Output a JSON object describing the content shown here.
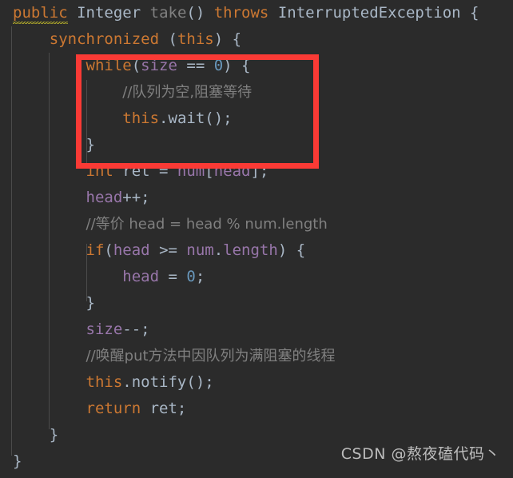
{
  "editor": {
    "theme": "darcula",
    "background_color": "#2b2b2b",
    "language": "java",
    "colors": {
      "keyword": "#cc7832",
      "plain": "#a9b7c6",
      "field": "#9876aa",
      "number": "#6897bb",
      "comment": "#808080",
      "dimmed_method": "#808080",
      "warning_squiggle": "#bbb529",
      "indent_guide": "#4b4b4b",
      "annotation_red": "#fa3a35"
    }
  },
  "code_lines": [
    {
      "id": "line-1",
      "indent": 0,
      "tokens": [
        {
          "text": "public",
          "kind": "keyword",
          "warning_underline": true
        },
        {
          "text": " ",
          "kind": "plain"
        },
        {
          "text": "Integer",
          "kind": "class"
        },
        {
          "text": " ",
          "kind": "plain"
        },
        {
          "text": "take",
          "kind": "dimmed_method"
        },
        {
          "text": "() ",
          "kind": "plain"
        },
        {
          "text": "throws",
          "kind": "keyword"
        },
        {
          "text": " ",
          "kind": "plain"
        },
        {
          "text": "InterruptedException",
          "kind": "class"
        },
        {
          "text": " {",
          "kind": "plain"
        }
      ]
    },
    {
      "id": "line-2",
      "indent": 1,
      "tokens": [
        {
          "text": "synchronized",
          "kind": "keyword"
        },
        {
          "text": " (",
          "kind": "plain"
        },
        {
          "text": "this",
          "kind": "keyword"
        },
        {
          "text": ") {",
          "kind": "plain"
        }
      ]
    },
    {
      "id": "line-3",
      "indent": 2,
      "tokens": [
        {
          "text": "while",
          "kind": "keyword"
        },
        {
          "text": "(",
          "kind": "plain"
        },
        {
          "text": "size",
          "kind": "field"
        },
        {
          "text": " == ",
          "kind": "plain"
        },
        {
          "text": "0",
          "kind": "number"
        },
        {
          "text": ") {",
          "kind": "plain"
        }
      ]
    },
    {
      "id": "line-4",
      "indent": 3,
      "tokens": [
        {
          "text": "//队列为空,阻塞等待",
          "kind": "comment"
        }
      ]
    },
    {
      "id": "line-5",
      "indent": 3,
      "tokens": [
        {
          "text": "this",
          "kind": "keyword"
        },
        {
          "text": ".",
          "kind": "plain"
        },
        {
          "text": "wait",
          "kind": "plain"
        },
        {
          "text": "();",
          "kind": "plain"
        }
      ]
    },
    {
      "id": "line-6",
      "indent": 2,
      "tokens": [
        {
          "text": "}",
          "kind": "plain"
        }
      ]
    },
    {
      "id": "line-7",
      "indent": 2,
      "tokens": [
        {
          "text": "int",
          "kind": "keyword"
        },
        {
          "text": " ret = ",
          "kind": "plain"
        },
        {
          "text": "num",
          "kind": "field"
        },
        {
          "text": "[",
          "kind": "plain"
        },
        {
          "text": "head",
          "kind": "field"
        },
        {
          "text": "];",
          "kind": "plain"
        }
      ]
    },
    {
      "id": "line-8",
      "indent": 2,
      "tokens": [
        {
          "text": "head",
          "kind": "field"
        },
        {
          "text": "++;",
          "kind": "plain"
        }
      ]
    },
    {
      "id": "line-9",
      "indent": 2,
      "tokens": [
        {
          "text": "//等价 head = head % num.length",
          "kind": "comment"
        }
      ]
    },
    {
      "id": "line-10",
      "indent": 2,
      "tokens": [
        {
          "text": "if",
          "kind": "keyword"
        },
        {
          "text": "(",
          "kind": "plain"
        },
        {
          "text": "head",
          "kind": "field"
        },
        {
          "text": " >= ",
          "kind": "plain"
        },
        {
          "text": "num",
          "kind": "field"
        },
        {
          "text": ".",
          "kind": "plain"
        },
        {
          "text": "length",
          "kind": "field"
        },
        {
          "text": ") {",
          "kind": "plain"
        }
      ]
    },
    {
      "id": "line-11",
      "indent": 3,
      "tokens": [
        {
          "text": "head",
          "kind": "field"
        },
        {
          "text": " = ",
          "kind": "plain"
        },
        {
          "text": "0",
          "kind": "number"
        },
        {
          "text": ";",
          "kind": "plain"
        }
      ]
    },
    {
      "id": "line-12",
      "indent": 2,
      "tokens": [
        {
          "text": "}",
          "kind": "plain"
        }
      ]
    },
    {
      "id": "line-13",
      "indent": 2,
      "tokens": [
        {
          "text": "size",
          "kind": "field"
        },
        {
          "text": "--;",
          "kind": "plain"
        }
      ]
    },
    {
      "id": "line-14",
      "indent": 2,
      "tokens": [
        {
          "text": "//唤醒put方法中因队列为满阻塞的线程",
          "kind": "comment"
        }
      ]
    },
    {
      "id": "line-15",
      "indent": 2,
      "tokens": [
        {
          "text": "this",
          "kind": "keyword"
        },
        {
          "text": ".",
          "kind": "plain"
        },
        {
          "text": "notify",
          "kind": "plain"
        },
        {
          "text": "();",
          "kind": "plain"
        }
      ]
    },
    {
      "id": "line-16",
      "indent": 2,
      "tokens": [
        {
          "text": "return",
          "kind": "keyword"
        },
        {
          "text": " ret;",
          "kind": "plain"
        }
      ]
    },
    {
      "id": "line-17",
      "indent": 1,
      "tokens": [
        {
          "text": "}",
          "kind": "plain"
        }
      ]
    },
    {
      "id": "line-18",
      "indent": 0,
      "tokens": [
        {
          "text": "}",
          "kind": "plain"
        }
      ]
    }
  ],
  "annotation": {
    "type": "rectangle-highlight",
    "color": "#fa3a35",
    "covers_lines": [
      "line-3",
      "line-4",
      "line-5",
      "line-6"
    ],
    "label": "while-wait-block-highlight"
  },
  "watermark": {
    "text": "CSDN @熬夜磕代码丶"
  }
}
